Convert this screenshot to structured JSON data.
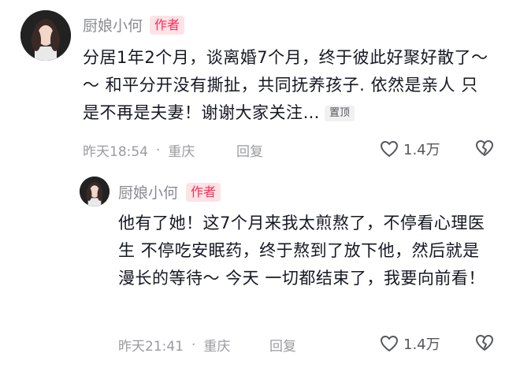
{
  "comments": [
    {
      "username": "厨娘小何",
      "badge": "作者",
      "text": "分居1年2个月，谈离婚7个月，终于彼此好聚好散了～～ 和平分开没有撕扯，共同抚养孩子. 依然是亲人 只是不再是夫妻！谢谢大家关注…",
      "pinned_label": "置顶",
      "time": "昨天18:54",
      "separator": "·",
      "location": "重庆",
      "reply_label": "回复",
      "likes": "1.4万"
    },
    {
      "username": "厨娘小何",
      "badge": "作者",
      "text": "他有了她！这7个月来我太煎熬了，不停看心理医生 不停吃安眠药，终于熬到了放下他，然后就是漫长的等待～ 今天 一切都结束了，我要向前看！",
      "time": "昨天21:41",
      "separator": "·",
      "location": "重庆",
      "reply_label": "回复",
      "likes": "1.4万"
    }
  ],
  "icons": {
    "like": "heart-outline-icon",
    "dislike": "broken-heart-outline-icon"
  },
  "colors": {
    "badge_text": "#fe2c55",
    "badge_bg": "#fde3e6",
    "meta_text": "#9a9ba1",
    "username_text": "#8a8b91"
  }
}
